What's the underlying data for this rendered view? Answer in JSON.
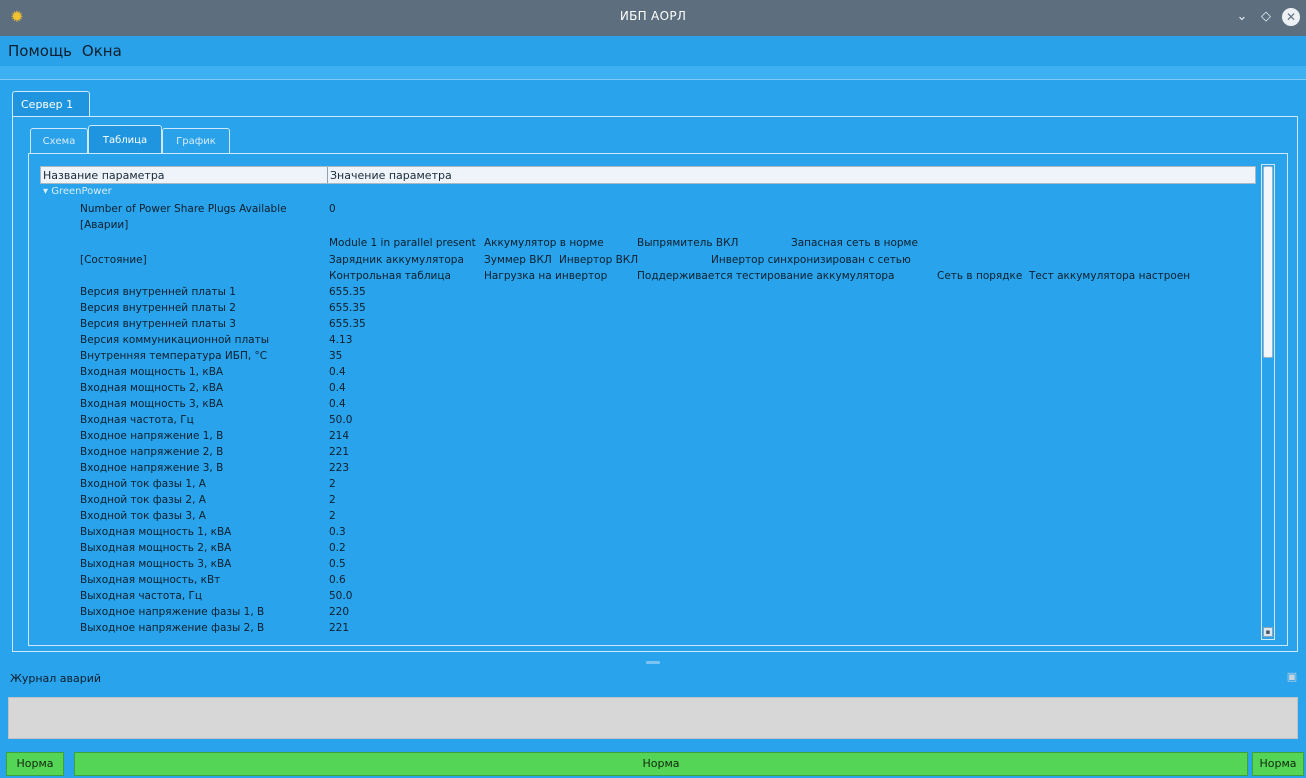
{
  "window": {
    "title": "ИБП АОРЛ",
    "icon": "gear-icon",
    "controls": [
      "chevron-down-icon",
      "diamond-icon",
      "close-icon"
    ]
  },
  "menu": {
    "items": [
      "Помощь",
      "Окна"
    ]
  },
  "server_tab": {
    "label": "Сервер 1"
  },
  "subtabs": [
    {
      "label": "Схема",
      "active": false
    },
    {
      "label": "Таблица",
      "active": true
    },
    {
      "label": "График",
      "active": false
    }
  ],
  "table": {
    "headers": [
      "Название параметра",
      "Значение параметра"
    ],
    "group": "GreenPower",
    "rows": [
      {
        "name": "Number of Power Share Plugs Available",
        "value": "0"
      },
      {
        "name": "[Аварии]",
        "value": ""
      },
      {
        "name": "[Состояние]",
        "value": ""
      },
      {
        "name": "Версия внутренней платы 1",
        "value": "655.35"
      },
      {
        "name": "Версия внутренней платы 2",
        "value": "655.35"
      },
      {
        "name": "Версия внутренней платы 3",
        "value": "655.35"
      },
      {
        "name": "Версия коммуникационной платы",
        "value": "4.13"
      },
      {
        "name": "Внутренняя температура ИБП, °С",
        "value": "35"
      },
      {
        "name": "Входная мощность 1, кВА",
        "value": "0.4"
      },
      {
        "name": "Входная мощность 2, кВА",
        "value": "0.4"
      },
      {
        "name": "Входная мощность 3, кВА",
        "value": "0.4"
      },
      {
        "name": "Входная частота, Гц",
        "value": "50.0"
      },
      {
        "name": "Входное напряжение 1, В",
        "value": "214"
      },
      {
        "name": "Входное напряжение 2, В",
        "value": "221"
      },
      {
        "name": "Входное напряжение 3, В",
        "value": "223"
      },
      {
        "name": "Входной ток фазы 1, А",
        "value": "2"
      },
      {
        "name": "Входной ток фазы 2, А",
        "value": "2"
      },
      {
        "name": "Входной ток фазы 3, А",
        "value": "2"
      },
      {
        "name": "Выходная мощность 1, кВА",
        "value": "0.3"
      },
      {
        "name": "Выходная мощность 2, кВА",
        "value": "0.2"
      },
      {
        "name": "Выходная мощность 3, кВА",
        "value": "0.5"
      },
      {
        "name": "Выходная мощность, кВт",
        "value": "0.6"
      },
      {
        "name": "Выходная частота, Гц",
        "value": "50.0"
      },
      {
        "name": "Выходное напряжение фазы 1, В",
        "value": "220"
      },
      {
        "name": "Выходное напряжение фазы 2, В",
        "value": "221"
      }
    ],
    "state_lines": [
      [
        "Module 1 in parallel present",
        "Аккумулятор в норме",
        "Выпрямитель ВКЛ",
        "Запасная сеть в норме"
      ],
      [
        "Зарядник аккумулятора",
        "Зуммер ВКЛ",
        "Инвертор ВКЛ",
        "Инвертор синхронизирован с сетью"
      ],
      [
        "Контрольная таблица",
        "Нагрузка на инвертор",
        "Поддерживается тестирование аккумулятора",
        "Сеть в порядке",
        "Тест аккумулятора настроен"
      ]
    ]
  },
  "alarm_journal": {
    "label": "Журнал аварий"
  },
  "status": {
    "left": "Норма",
    "center": "Норма",
    "right": "Норма",
    "color": "#55d556"
  }
}
